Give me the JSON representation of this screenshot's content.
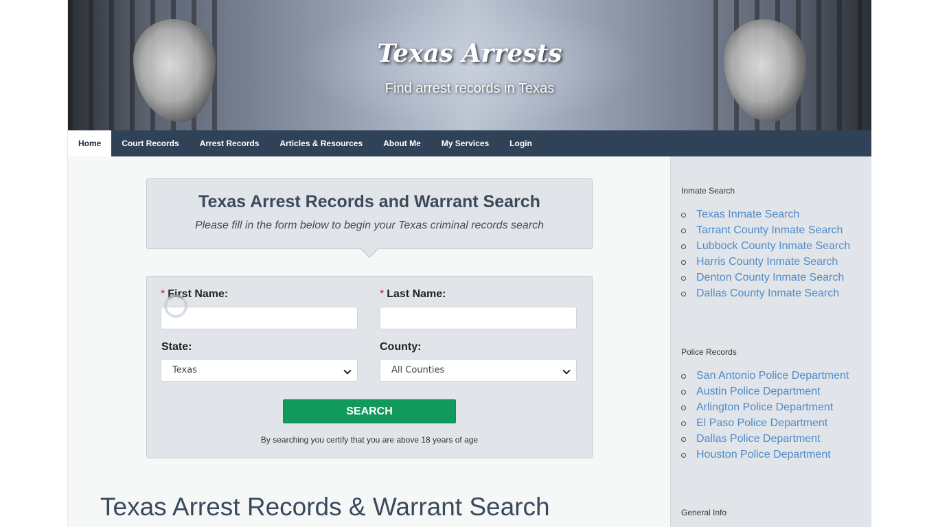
{
  "header": {
    "site_title": "Texas Arrests",
    "tagline": "Find arrest records in Texas"
  },
  "nav": {
    "items": [
      {
        "label": "Home",
        "active": true
      },
      {
        "label": "Court Records"
      },
      {
        "label": "Arrest Records"
      },
      {
        "label": "Articles & Resources"
      },
      {
        "label": "About Me"
      },
      {
        "label": "My Services"
      },
      {
        "label": "Login"
      }
    ]
  },
  "search": {
    "title": "Texas Arrest Records and Warrant Search",
    "subtitle": "Please fill in the form below to begin your Texas criminal records search",
    "required_mark": "*",
    "first_name_label": "First Name:",
    "last_name_label": "Last Name:",
    "first_name_value": "",
    "last_name_value": "",
    "state_label": "State:",
    "state_value": "Texas",
    "county_label": "County:",
    "county_value": "All Counties",
    "button_label": "SEARCH",
    "certify_text": "By searching you certify that you are above 18 years of age"
  },
  "main": {
    "heading": "Texas Arrest Records & Warrant Search"
  },
  "sidebar": {
    "inmate": {
      "title": "Inmate Search",
      "links": [
        "Texas Inmate Search",
        "Tarrant County Inmate Search",
        "Lubbock County Inmate Search",
        "Harris County Inmate Search",
        "Denton County Inmate Search",
        "Dallas County Inmate Search"
      ]
    },
    "police": {
      "title": "Police Records",
      "links": [
        "San Antonio Police Department",
        "Austin Police Department",
        "Arlington Police Department",
        "El Paso Police Department",
        "Dallas Police Department",
        "Houston Police Department"
      ]
    },
    "general": {
      "title": "General Info"
    }
  },
  "colors": {
    "nav_background": "#2f4257",
    "search_button": "#119a5c",
    "link": "#4f8bc7",
    "required_asterisk": "#d22020"
  }
}
